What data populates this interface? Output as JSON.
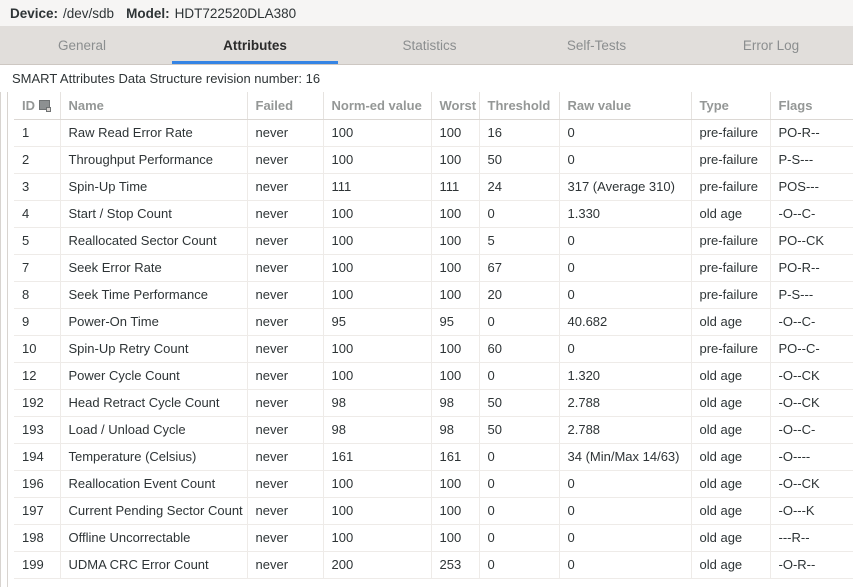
{
  "header": {
    "device_label": "Device:",
    "device_value": "/dev/sdb",
    "model_label": "Model:",
    "model_value": "HDT722520DLA380"
  },
  "tabs": [
    {
      "label": "General",
      "active": false
    },
    {
      "label": "Attributes",
      "active": true
    },
    {
      "label": "Statistics",
      "active": false
    },
    {
      "label": "Self-Tests",
      "active": false
    },
    {
      "label": "Error Log",
      "active": false
    }
  ],
  "revision_line": "SMART Attributes Data Structure revision number: 16",
  "table": {
    "columns": [
      {
        "key": "id",
        "label": "ID",
        "icon": "sort-indicator-icon"
      },
      {
        "key": "name",
        "label": "Name"
      },
      {
        "key": "failed",
        "label": "Failed"
      },
      {
        "key": "normed",
        "label": "Norm-ed value"
      },
      {
        "key": "worst",
        "label": "Worst"
      },
      {
        "key": "threshold",
        "label": "Threshold"
      },
      {
        "key": "raw",
        "label": "Raw value"
      },
      {
        "key": "type",
        "label": "Type"
      },
      {
        "key": "flags",
        "label": "Flags"
      }
    ],
    "rows": [
      {
        "id": "1",
        "name": "Raw Read Error Rate",
        "failed": "never",
        "normed": "100",
        "worst": "100",
        "threshold": "16",
        "raw": "0",
        "type": "pre-failure",
        "flags": "PO-R--"
      },
      {
        "id": "2",
        "name": "Throughput Performance",
        "failed": "never",
        "normed": "100",
        "worst": "100",
        "threshold": "50",
        "raw": "0",
        "type": "pre-failure",
        "flags": "P-S---"
      },
      {
        "id": "3",
        "name": "Spin-Up Time",
        "failed": "never",
        "normed": "111",
        "worst": "111",
        "threshold": "24",
        "raw": "317 (Average 310)",
        "type": "pre-failure",
        "flags": "POS---"
      },
      {
        "id": "4",
        "name": "Start / Stop Count",
        "failed": "never",
        "normed": "100",
        "worst": "100",
        "threshold": "0",
        "raw": "1.330",
        "type": "old age",
        "flags": "-O--C-"
      },
      {
        "id": "5",
        "name": "Reallocated Sector Count",
        "failed": "never",
        "normed": "100",
        "worst": "100",
        "threshold": "5",
        "raw": "0",
        "type": "pre-failure",
        "flags": "PO--CK"
      },
      {
        "id": "7",
        "name": "Seek Error Rate",
        "failed": "never",
        "normed": "100",
        "worst": "100",
        "threshold": "67",
        "raw": "0",
        "type": "pre-failure",
        "flags": "PO-R--"
      },
      {
        "id": "8",
        "name": "Seek Time Performance",
        "failed": "never",
        "normed": "100",
        "worst": "100",
        "threshold": "20",
        "raw": "0",
        "type": "pre-failure",
        "flags": "P-S---"
      },
      {
        "id": "9",
        "name": "Power-On Time",
        "failed": "never",
        "normed": "95",
        "worst": "95",
        "threshold": "0",
        "raw": "40.682",
        "type": "old age",
        "flags": "-O--C-"
      },
      {
        "id": "10",
        "name": "Spin-Up Retry Count",
        "failed": "never",
        "normed": "100",
        "worst": "100",
        "threshold": "60",
        "raw": "0",
        "type": "pre-failure",
        "flags": "PO--C-"
      },
      {
        "id": "12",
        "name": "Power Cycle Count",
        "failed": "never",
        "normed": "100",
        "worst": "100",
        "threshold": "0",
        "raw": "1.320",
        "type": "old age",
        "flags": "-O--CK"
      },
      {
        "id": "192",
        "name": "Head Retract Cycle Count",
        "failed": "never",
        "normed": "98",
        "worst": "98",
        "threshold": "50",
        "raw": "2.788",
        "type": "old age",
        "flags": "-O--CK"
      },
      {
        "id": "193",
        "name": "Load / Unload Cycle",
        "failed": "never",
        "normed": "98",
        "worst": "98",
        "threshold": "50",
        "raw": "2.788",
        "type": "old age",
        "flags": "-O--C-"
      },
      {
        "id": "194",
        "name": "Temperature (Celsius)",
        "failed": "never",
        "normed": "161",
        "worst": "161",
        "threshold": "0",
        "raw": "34 (Min/Max 14/63)",
        "type": "old age",
        "flags": "-O----"
      },
      {
        "id": "196",
        "name": "Reallocation Event Count",
        "failed": "never",
        "normed": "100",
        "worst": "100",
        "threshold": "0",
        "raw": "0",
        "type": "old age",
        "flags": "-O--CK"
      },
      {
        "id": "197",
        "name": "Current Pending Sector Count",
        "failed": "never",
        "normed": "100",
        "worst": "100",
        "threshold": "0",
        "raw": "0",
        "type": "old age",
        "flags": "-O---K"
      },
      {
        "id": "198",
        "name": "Offline Uncorrectable",
        "failed": "never",
        "normed": "100",
        "worst": "100",
        "threshold": "0",
        "raw": "0",
        "type": "old age",
        "flags": "---R--"
      },
      {
        "id": "199",
        "name": "UDMA CRC Error Count",
        "failed": "never",
        "normed": "200",
        "worst": "253",
        "threshold": "0",
        "raw": "0",
        "type": "old age",
        "flags": "-O-R--"
      }
    ]
  },
  "colors": {
    "accent": "#3584e4",
    "header_bg": "#f6f5f4",
    "tabbar_bg": "#e1dedb",
    "text": "#2e3436",
    "muted": "#949796"
  }
}
